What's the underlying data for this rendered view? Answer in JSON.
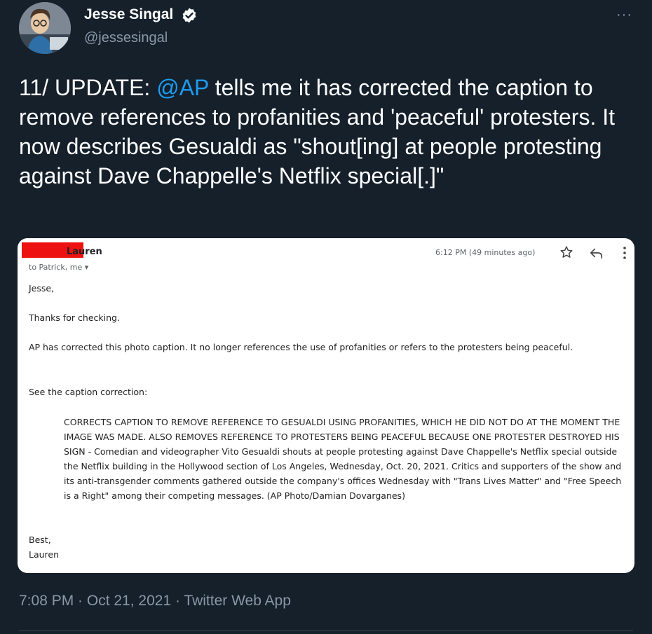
{
  "tweet": {
    "author_name": "Jesse Singal",
    "handle": "@jessesingal",
    "more_icon": "···",
    "text_prefix": "11/ UPDATE: ",
    "mention": "@AP",
    "text_body": " tells me it has corrected the caption to remove references to profanities and 'peaceful' protesters. It now describes Gesualdi as \"shout[ing] at people protesting against Dave Chappelle's Netflix special[.]\"",
    "meta": "7:08 PM · Oct 21, 2021 · Twitter Web App"
  },
  "email": {
    "sender": "Lauren",
    "recipients": "to Patrick, me ▾",
    "time": "6:12 PM (49 minutes ago)",
    "greeting": "Jesse,",
    "line1": "Thanks for checking.",
    "line2": "AP has corrected this photo caption. It no longer references the use of profanities or refers to the protesters being peaceful.",
    "line3": "See the caption correction:",
    "quote": "CORRECTS CAPTION TO REMOVE REFERENCE TO GESUALDI USING PROFANITIES, WHICH HE DID NOT DO AT THE MOMENT THE IMAGE WAS MADE. ALSO REMOVES REFERENCE TO PROTESTERS BEING PEACEFUL BECAUSE ONE PROTESTER DESTROYED HIS SIGN - Comedian and videographer Vito Gesualdi shouts at people protesting against Dave Chappelle's Netflix special outside the Netflix building in the Hollywood section of Los Angeles, Wednesday, Oct. 20, 2021. Critics and supporters of the show and its anti-transgender comments gathered outside the company's offices Wednesday with \"Trans Lives Matter\" and \"Free Speech is a Right\" among their competing messages. (AP Photo/Damian Dovarganes)",
    "signoff": "Best,",
    "signature": "Lauren"
  },
  "colors": {
    "background": "#15202b",
    "link": "#1d9bf0",
    "muted": "#8b98a5",
    "redaction": "#ee1111"
  }
}
